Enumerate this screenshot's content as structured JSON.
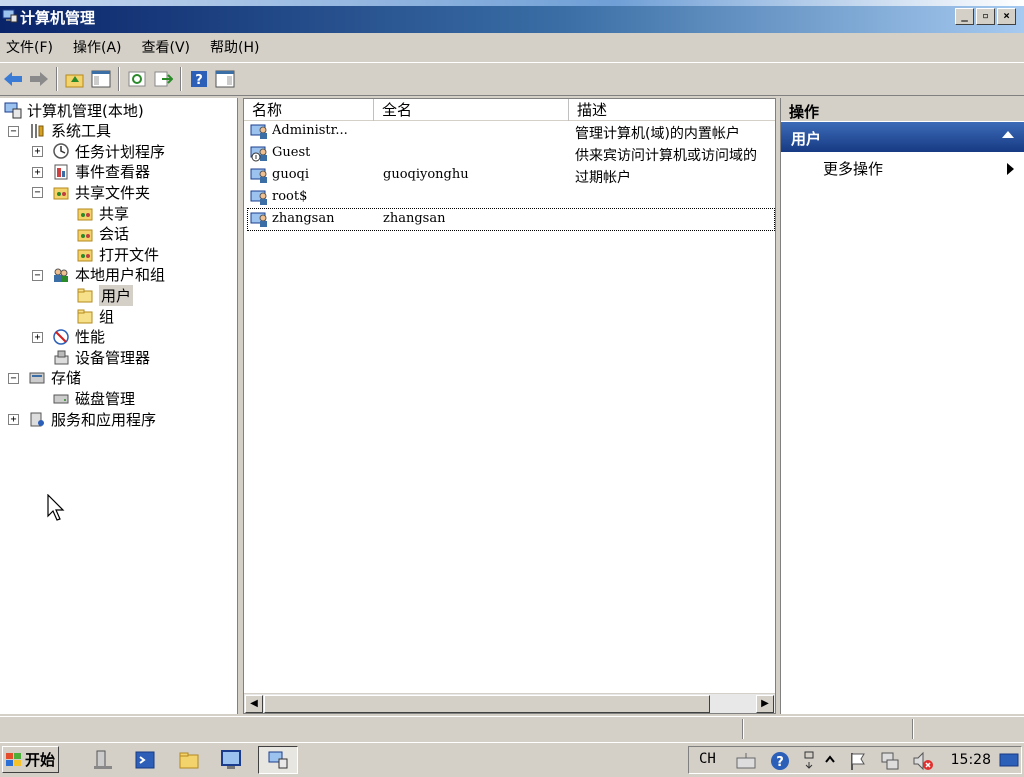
{
  "window": {
    "title": "计算机管理"
  },
  "menu": [
    "文件(F)",
    "操作(A)",
    "查看(V)",
    "帮助(H)"
  ],
  "tree": [
    {
      "label": "计算机管理(本地)",
      "icon": "computer-management-icon",
      "level": 0
    },
    {
      "label": "系统工具",
      "icon": "tools-icon",
      "level": 1,
      "expander": "−"
    },
    {
      "label": "任务计划程序",
      "icon": "clock-icon",
      "level": 2,
      "expander": "+"
    },
    {
      "label": "事件查看器",
      "icon": "event-viewer-icon",
      "level": 2,
      "expander": "+"
    },
    {
      "label": "共享文件夹",
      "icon": "shared-folder-icon",
      "level": 2,
      "expander": "−"
    },
    {
      "label": "共享",
      "icon": "shared-folder-icon",
      "level": 3
    },
    {
      "label": "会话",
      "icon": "shared-folder-icon",
      "level": 3
    },
    {
      "label": "打开文件",
      "icon": "shared-folder-icon",
      "level": 3
    },
    {
      "label": "本地用户和组",
      "icon": "users-icon",
      "level": 2,
      "expander": "−"
    },
    {
      "label": "用户",
      "icon": "folder-icon",
      "level": 3,
      "selected": true
    },
    {
      "label": "组",
      "icon": "folder-icon",
      "level": 3
    },
    {
      "label": "性能",
      "icon": "performance-icon",
      "level": 2,
      "expander": "+"
    },
    {
      "label": "设备管理器",
      "icon": "device-manager-icon",
      "level": 2
    },
    {
      "label": "存储",
      "icon": "storage-icon",
      "level": 1,
      "expander": "−"
    },
    {
      "label": "磁盘管理",
      "icon": "disk-icon",
      "level": 2
    },
    {
      "label": "服务和应用程序",
      "icon": "services-icon",
      "level": 1,
      "expander": "+"
    }
  ],
  "list": {
    "columns": [
      "名称",
      "全名",
      "描述"
    ],
    "rows": [
      {
        "name": "Administr...",
        "fullname": "",
        "desc": "管理计算机(域)的内置帐户"
      },
      {
        "name": "Guest",
        "fullname": "",
        "desc": "供来宾访问计算机或访问域的"
      },
      {
        "name": "guoqi",
        "fullname": "guoqiyonghu",
        "desc": "过期帐户"
      },
      {
        "name": "root$",
        "fullname": "",
        "desc": ""
      },
      {
        "name": "zhangsan",
        "fullname": "zhangsan",
        "desc": ""
      }
    ]
  },
  "actions": {
    "title": "操作",
    "section": "用户",
    "item": "更多操作"
  },
  "taskbar": {
    "start": "开始",
    "lang": "CH",
    "clock": "15:28"
  },
  "colors": {
    "title_dark": "#0a246a",
    "selection_bar": "#3c6bb8"
  }
}
